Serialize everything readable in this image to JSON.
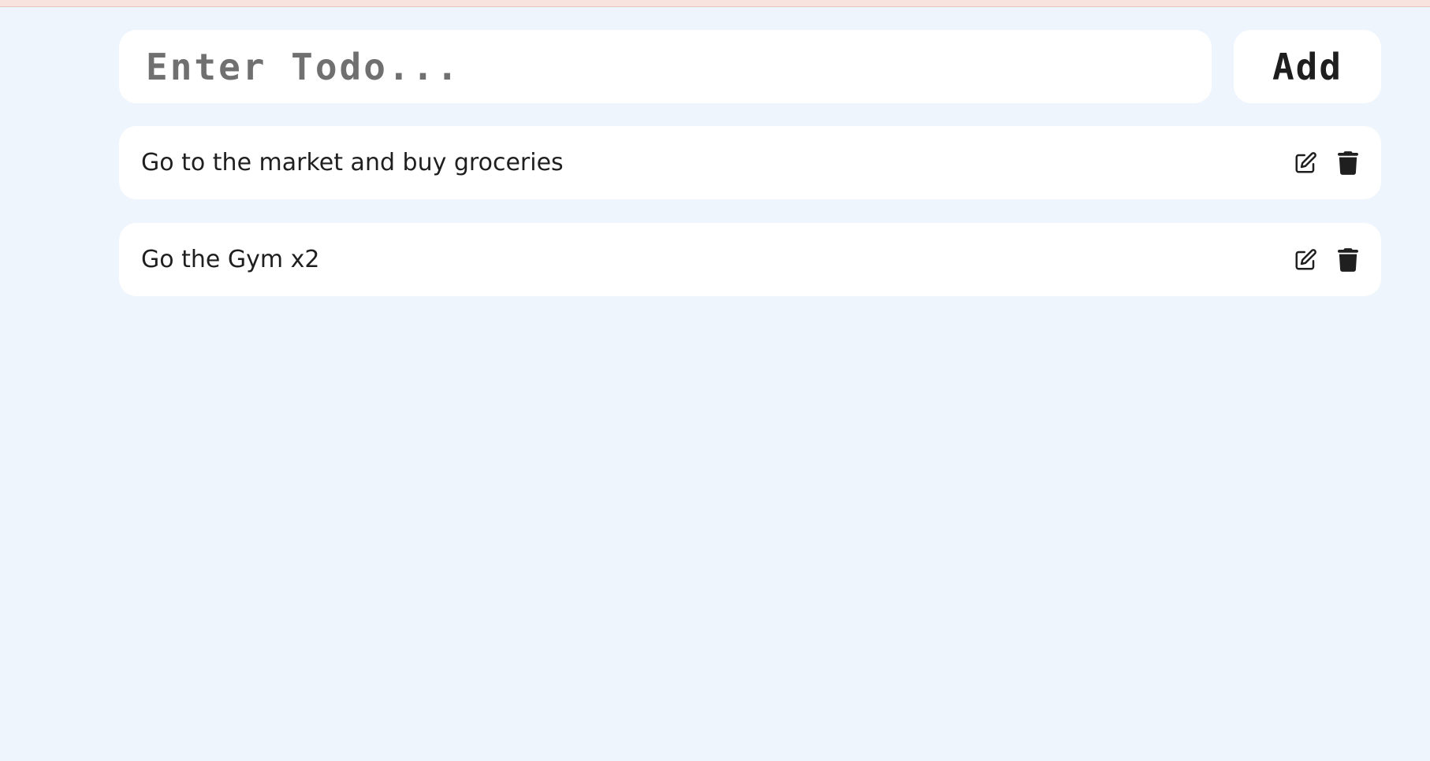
{
  "input": {
    "placeholder": "Enter Todo...",
    "value": ""
  },
  "add_button": {
    "label": "Add"
  },
  "todos": [
    {
      "text": "Go to the market and buy groceries",
      "edit_icon": "edit-icon",
      "delete_icon": "trash-icon"
    },
    {
      "text": "Go the Gym x2",
      "edit_icon": "edit-icon",
      "delete_icon": "trash-icon"
    }
  ],
  "colors": {
    "page_background": "#eef5fd",
    "card_background": "#ffffff",
    "top_strip": "#f8e3df",
    "text": "#1f1f1f",
    "placeholder": "#707070"
  }
}
